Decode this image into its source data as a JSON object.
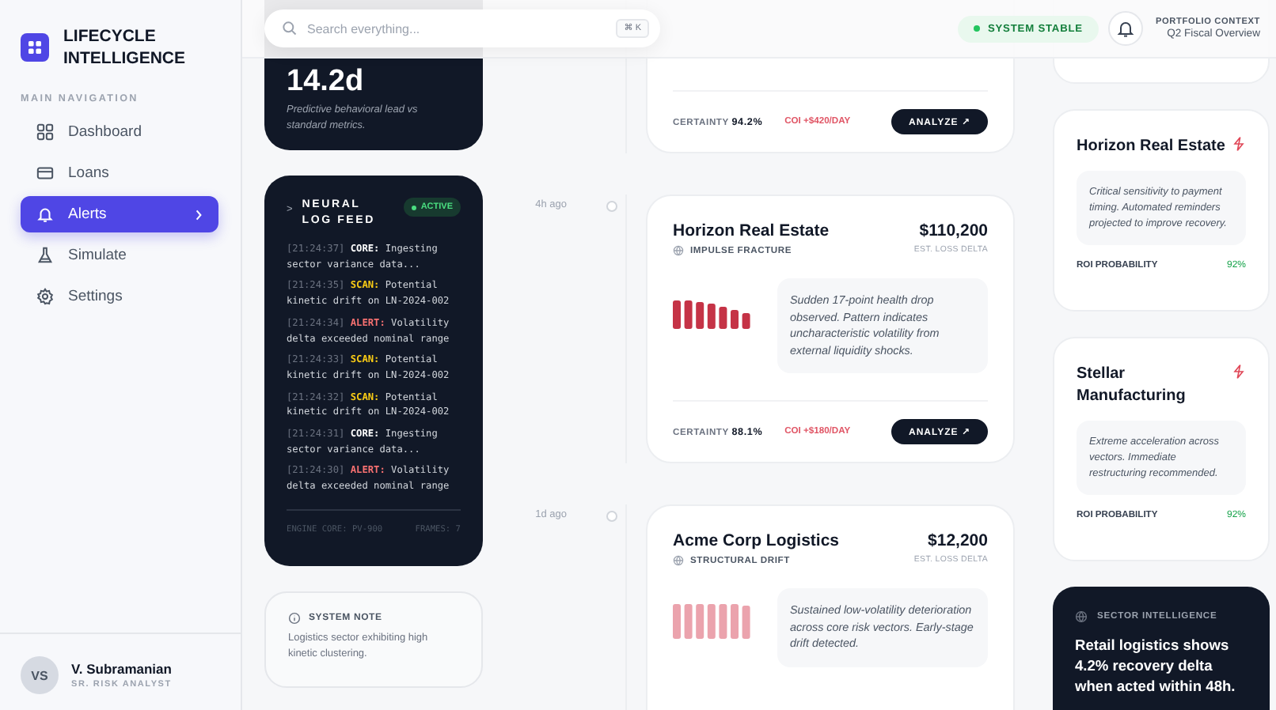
{
  "brand": {
    "title": "LIFECYCLE INTELLIGENCE"
  },
  "sidebar": {
    "section_label": "MAIN NAVIGATION",
    "items": [
      {
        "label": "Dashboard",
        "selected": false
      },
      {
        "label": "Loans",
        "selected": false
      },
      {
        "label": "Alerts",
        "selected": true
      },
      {
        "label": "Simulate",
        "selected": false
      },
      {
        "label": "Settings",
        "selected": false
      }
    ],
    "user": {
      "initials": "VS",
      "name": "V. Subramanian",
      "role": "SR. RISK ANALYST"
    }
  },
  "header": {
    "search": {
      "placeholder": "Search everything...",
      "shortcut": "⌘ K"
    },
    "status": "SYSTEM STABLE",
    "context_label": "PORTFOLIO CONTEXT",
    "context_value": "Q2 Fiscal Overview"
  },
  "lead_card": {
    "value": "14.2d",
    "description": "Predictive behavioral lead vs standard metrics."
  },
  "log_feed": {
    "title": "NEURAL LOG FEED",
    "prompt": ">",
    "badge": "ACTIVE",
    "lines": [
      {
        "time": "[21:24:37]",
        "kind": "core",
        "tag": "CORE:",
        "text": "Ingesting sector variance data..."
      },
      {
        "time": "[21:24:35]",
        "kind": "scan",
        "tag": "SCAN:",
        "text": "Potential kinetic drift on LN-2024-002"
      },
      {
        "time": "[21:24:34]",
        "kind": "alert",
        "tag": "ALERT:",
        "text": "Volatility delta exceeded nominal range"
      },
      {
        "time": "[21:24:33]",
        "kind": "scan",
        "tag": "SCAN:",
        "text": "Potential kinetic drift on LN-2024-002"
      },
      {
        "time": "[21:24:32]",
        "kind": "scan",
        "tag": "SCAN:",
        "text": "Potential kinetic drift on LN-2024-002"
      },
      {
        "time": "[21:24:31]",
        "kind": "core",
        "tag": "CORE:",
        "text": "Ingesting sector variance data..."
      },
      {
        "time": "[21:24:30]",
        "kind": "alert",
        "tag": "ALERT:",
        "text": "Volatility delta exceeded nominal range"
      }
    ],
    "engine": "ENGINE CORE: PV-900",
    "frames": "FRAMES: 7"
  },
  "system_note": {
    "title": "SYSTEM NOTE",
    "text": "Logistics sector exhibiting high kinetic clustering."
  },
  "alerts": [
    {
      "certainty_label": "CERTAINTY",
      "certainty": "94.2%",
      "coi": "COI +$420/DAY",
      "action": "ANALYZE ↗"
    },
    {
      "time": "4h ago",
      "name": "Horizon Real Estate",
      "amount": "$110,200",
      "amount_label": "EST. LOSS DELTA",
      "kind": "impulse",
      "pattern": "IMPULSE FRACTURE",
      "description": "Sudden 17-point health drop observed. Pattern indicates uncharacteristic volatility from external liquidity shocks.",
      "certainty_label": "CERTAINTY",
      "certainty": "88.1%",
      "coi": "COI +$180/DAY",
      "action": "ANALYZE ↗"
    },
    {
      "time": "1d ago",
      "name": "Acme Corp Logistics",
      "amount": "$12,200",
      "amount_label": "EST. LOSS DELTA",
      "kind": "drift",
      "pattern": "STRUCTURAL DRIFT",
      "description": "Sustained low-volatility deterioration across core risk vectors. Early-stage drift detected."
    }
  ],
  "recommendations": [
    {
      "name": "Horizon Real Estate",
      "text": "Critical sensitivity to payment timing. Automated reminders projected to improve recovery.",
      "metric_label": "ROI PROBABILITY",
      "metric": "92%"
    },
    {
      "name": "Stellar Manufacturing",
      "text": "Extreme acceleration across vectors. Immediate restructuring recommended.",
      "metric_label": "ROI PROBABILITY",
      "metric": "92%"
    }
  ],
  "sector_intelligence": {
    "title": "SECTOR INTELLIGENCE",
    "text": "Retail logistics shows 4.2% recovery delta when acted within 48h."
  }
}
